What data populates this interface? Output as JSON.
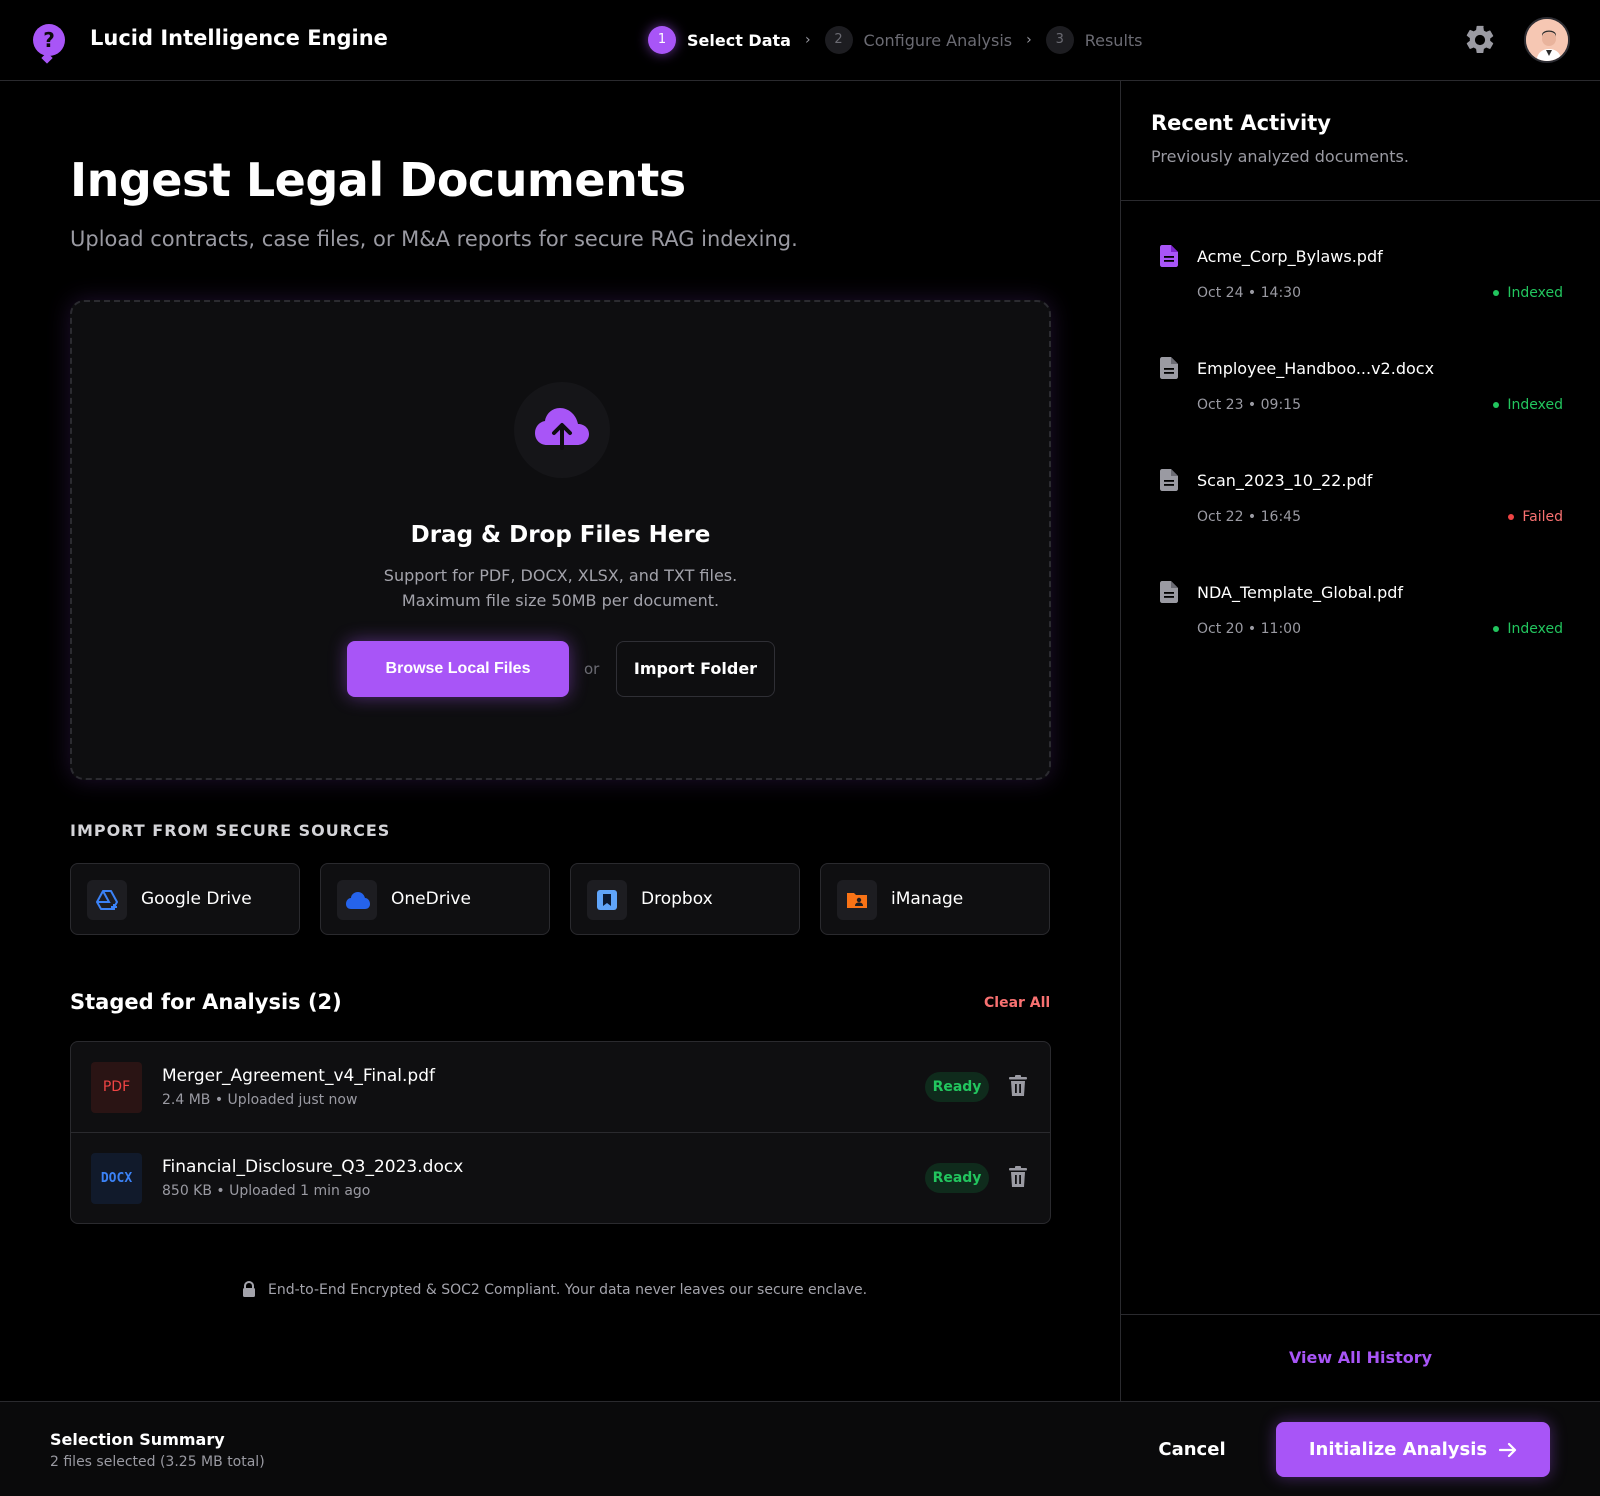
{
  "header": {
    "app_title": "Lucid Intelligence Engine",
    "logo_glyph": "?",
    "steps": [
      {
        "number": "1",
        "label": "Select Data",
        "active": true
      },
      {
        "number": "2",
        "label": "Configure Analysis",
        "active": false
      },
      {
        "number": "3",
        "label": "Results",
        "active": false
      }
    ],
    "settings_icon": "gear-icon",
    "avatar_icon": "user-avatar"
  },
  "main": {
    "title": "Ingest Legal Documents",
    "subtitle": "Upload contracts, case files, or M&A reports for secure RAG indexing.",
    "dropzone": {
      "icon": "cloud-upload-icon",
      "title": "Drag & Drop Files Here",
      "line1": "Support for PDF, DOCX, XLSX, and TXT files.",
      "line2": "Maximum file size 50MB per document.",
      "browse_label": "Browse Local Files",
      "or_label": "or",
      "import_label": "Import Folder"
    },
    "sources": {
      "heading": "IMPORT FROM SECURE SOURCES",
      "items": [
        {
          "label": "Google Drive",
          "icon": "google-drive-icon"
        },
        {
          "label": "OneDrive",
          "icon": "onedrive-cloud-icon"
        },
        {
          "label": "Dropbox",
          "icon": "dropbox-icon"
        },
        {
          "label": "iManage",
          "icon": "imanage-folder-icon"
        }
      ]
    },
    "staged": {
      "heading": "Staged for Analysis (2)",
      "clear_label": "Clear All",
      "files": [
        {
          "badge": "PDF",
          "name": "Merger_Agreement_v4_Final.pdf",
          "meta": "2.4 MB • Uploaded just now",
          "status": "Ready"
        },
        {
          "badge": "DOCX",
          "name": "Financial_Disclosure_Q3_2023.docx",
          "meta": "850 KB • Uploaded 1 min ago",
          "status": "Ready"
        }
      ]
    },
    "security_note": "End-to-End Encrypted & SOC2 Compliant. Your data never leaves our secure enclave."
  },
  "sidebar": {
    "title": "Recent Activity",
    "subtitle": "Previously analyzed documents.",
    "items": [
      {
        "name": "Acme_Corp_Bylaws.pdf",
        "time": "Oct 24 • 14:30",
        "status": "Indexed",
        "highlight": true
      },
      {
        "name": "Employee_Handboo...v2.docx",
        "time": "Oct 23 • 09:15",
        "status": "Indexed",
        "highlight": false
      },
      {
        "name": "Scan_2023_10_22.pdf",
        "time": "Oct 22 • 16:45",
        "status": "Failed",
        "highlight": false
      },
      {
        "name": "NDA_Template_Global.pdf",
        "time": "Oct 20 • 11:00",
        "status": "Indexed",
        "highlight": false
      }
    ],
    "view_all_label": "View All History"
  },
  "footer": {
    "summary_title": "Selection Summary",
    "summary_meta": "2 files selected (3.25 MB total)",
    "cancel_label": "Cancel",
    "init_label": "Initialize Analysis"
  },
  "colors": {
    "accent": "#a855f7",
    "success": "#22c55e",
    "danger": "#ef4444",
    "background": "#000000",
    "panel": "#0f0f11"
  }
}
